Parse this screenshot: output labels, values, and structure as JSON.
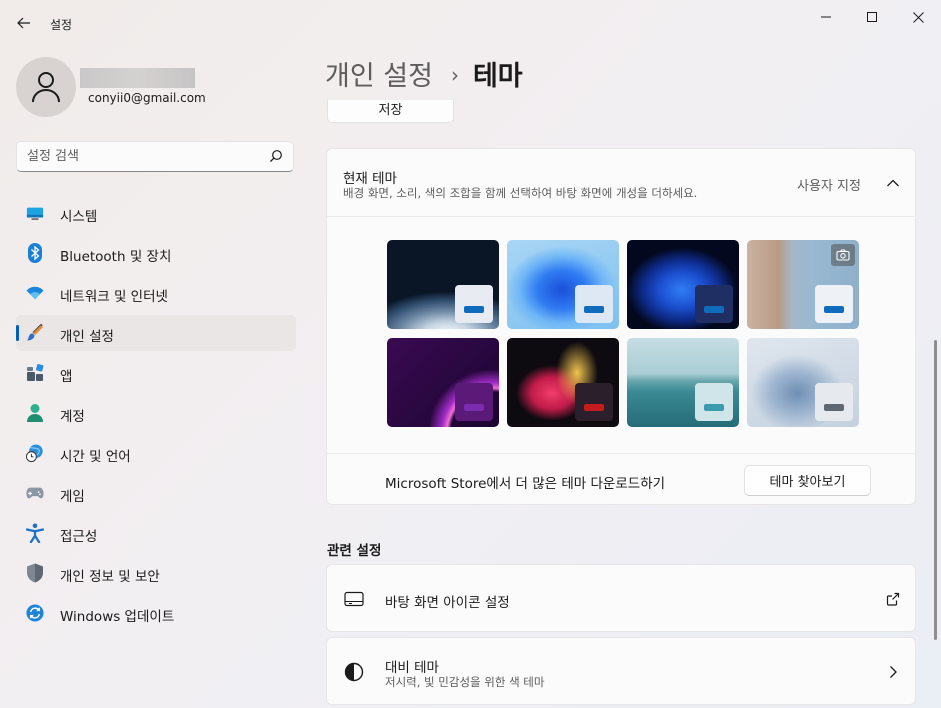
{
  "window": {
    "title": "설정"
  },
  "user": {
    "email": "conyii0@gmail.com"
  },
  "search": {
    "placeholder": "설정 검색"
  },
  "sidebar": {
    "items": [
      {
        "label": "시스템",
        "icon": "monitor-icon"
      },
      {
        "label": "Bluetooth 및 장치",
        "icon": "bluetooth-icon"
      },
      {
        "label": "네트워크 및 인터넷",
        "icon": "wifi-icon"
      },
      {
        "label": "개인 설정",
        "icon": "brush-icon",
        "selected": true
      },
      {
        "label": "앱",
        "icon": "apps-icon"
      },
      {
        "label": "계정",
        "icon": "person-icon"
      },
      {
        "label": "시간 및 언어",
        "icon": "clock-globe-icon"
      },
      {
        "label": "게임",
        "icon": "gamepad-icon"
      },
      {
        "label": "접근성",
        "icon": "accessibility-icon"
      },
      {
        "label": "개인 정보 및 보안",
        "icon": "shield-icon"
      },
      {
        "label": "Windows 업데이트",
        "icon": "update-icon"
      }
    ]
  },
  "breadcrumb": {
    "parent": "개인 설정",
    "separator": "›",
    "current": "테마"
  },
  "content": {
    "save_label": "저장",
    "current_theme": {
      "title": "현재 테마",
      "description": "배경 화면, 소리, 색의 조합을 함께 선택하여 바탕 화면에 개성을 더하세요.",
      "value": "사용자 지정"
    },
    "store": {
      "text": "Microsoft Store에서 더 많은 테마 다운로드하기",
      "button": "테마 찾아보기"
    },
    "related_title": "관련 설정",
    "related": [
      {
        "label": "바탕 화면 아이콘 설정",
        "icon": "desktop-icon",
        "trail": "external-link-icon"
      },
      {
        "label": "대비 테마",
        "sub": "저시력, 빛 민감성을 위한 색 테마",
        "icon": "contrast-icon",
        "trail": "chevron-right-icon"
      }
    ]
  },
  "colors": {
    "accent": "#005fb8"
  }
}
